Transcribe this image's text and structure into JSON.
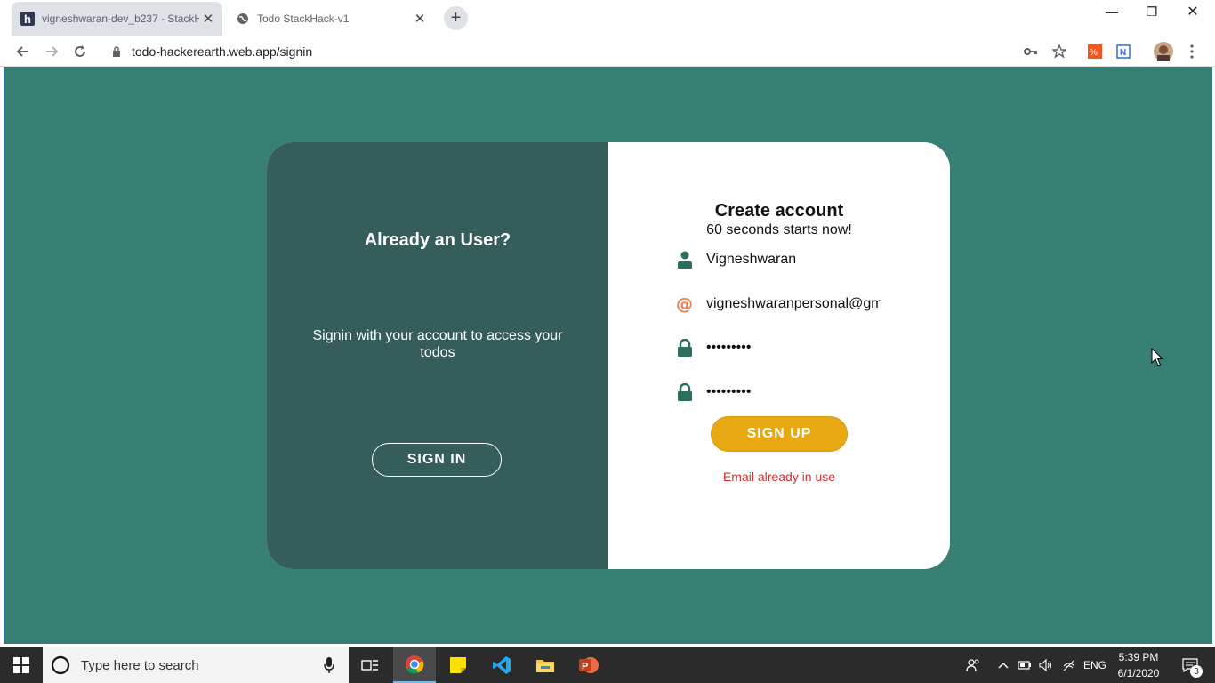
{
  "browser": {
    "tabs": [
      {
        "title": "vigneshwaran-dev_b237 - StackH",
        "close": "✕"
      },
      {
        "title": "Todo StackHack-v1",
        "close": "✕"
      }
    ],
    "new_tab": "+",
    "window_controls": {
      "minimize": "—",
      "restore": "❐",
      "close": "✕"
    },
    "url": "todo-hackerearth.web.app/signin"
  },
  "page": {
    "left_panel": {
      "heading": "Already an User?",
      "text": "Signin with your account to access your todos",
      "button": "SIGN IN"
    },
    "right_panel": {
      "heading": "Create account",
      "subheading": "60 seconds starts now!",
      "fields": [
        {
          "icon": "person-icon",
          "value": "Vigneshwaran"
        },
        {
          "icon": "at-icon",
          "value": "vigneshwaranpersonal@gm"
        },
        {
          "icon": "lock-icon",
          "value": "•••••••••"
        },
        {
          "icon": "lock-icon",
          "value": "•••••••••"
        }
      ],
      "button": "SIGN UP",
      "error": "Email already in use"
    }
  },
  "taskbar": {
    "search_placeholder": "Type here to search",
    "language": "ENG",
    "time": "5:39 PM",
    "date": "6/1/2020",
    "notifications": "3"
  },
  "colors": {
    "page_bg": "#367f72",
    "left_panel": "#355d5a",
    "signup": "#e8a812",
    "error": "#d32f2f",
    "icon_green": "#2e6e5e",
    "icon_orange": "#f07c4a"
  }
}
